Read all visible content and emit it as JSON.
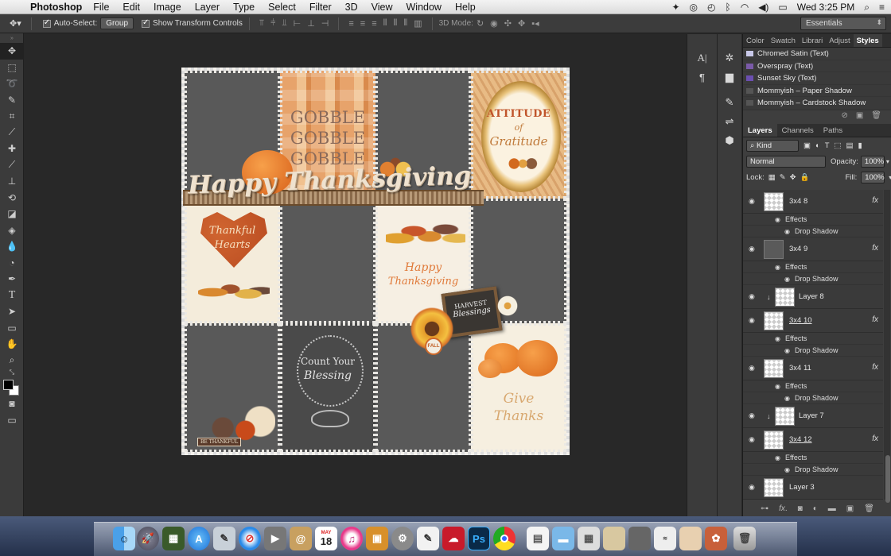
{
  "menubar": {
    "app_name": "Photoshop",
    "items": [
      "File",
      "Edit",
      "Image",
      "Layer",
      "Type",
      "Select",
      "Filter",
      "3D",
      "View",
      "Window",
      "Help"
    ],
    "clock": "Wed 3:25 PM"
  },
  "options_bar": {
    "auto_select_label": "Auto-Select:",
    "auto_select_value": "Group",
    "show_transform_label": "Show Transform Controls",
    "mode_3d_label": "3D Mode:",
    "workspace": "Essentials"
  },
  "canvas_art": {
    "gobble_lines": [
      "GOBBLE",
      "GOBBLE",
      "GOBBLE"
    ],
    "attitude_lines": [
      "ATTITUDE",
      "of",
      "Gratitude"
    ],
    "happy_thanksgiving": "Happy Thanksgiving",
    "thankful_hearts": [
      "Thankful",
      "Hearts"
    ],
    "card_happy": [
      "Happy",
      "Thanksgiving"
    ],
    "harvest_lines": [
      "HARVEST",
      "Blessings"
    ],
    "count_blessing": [
      "Count Your",
      "Blessing"
    ],
    "give_thanks": [
      "Give",
      "Thanks"
    ],
    "be_thankful": "BE THANKFUL",
    "fall_tag": "FALL"
  },
  "styles_panel": {
    "tabs": [
      "Color",
      "Swatch",
      "Librari",
      "Adjust",
      "Styles"
    ],
    "items": [
      {
        "label": "Chromed Satin (Text)",
        "color": "#c8c8e8"
      },
      {
        "label": "Overspray (Text)",
        "color": "#7a5aa8"
      },
      {
        "label": "Sunset Sky (Text)",
        "color": "#6b4fb0"
      },
      {
        "label": "Mommyish – Paper Shadow",
        "color": "#555555"
      },
      {
        "label": "Mommyish – Cardstock Shadow",
        "color": "#555555"
      }
    ]
  },
  "layers_panel": {
    "tabs": [
      "Layers",
      "Channels",
      "Paths"
    ],
    "filter_kind": "Kind",
    "blend_mode": "Normal",
    "opacity_label": "Opacity:",
    "opacity_value": "100%",
    "lock_label": "Lock:",
    "fill_label": "Fill:",
    "fill_value": "100%",
    "effects_label": "Effects",
    "drop_shadow_label": "Drop Shadow",
    "layers": [
      {
        "name": "3x4 8"
      },
      {
        "name": "3x4 9"
      },
      {
        "name": "Layer 8"
      },
      {
        "name": "3x4 10"
      },
      {
        "name": "3x4 11"
      },
      {
        "name": "Layer 7"
      },
      {
        "name": "3x4 12"
      },
      {
        "name": "Layer 3"
      }
    ]
  },
  "dock": {
    "apps": [
      "Finder",
      "Launchpad",
      "Photos",
      "App Store",
      "Preview",
      "Safari",
      "FaceTime",
      "Contacts",
      "Calendar",
      "iTunes",
      "iPhoto",
      "System Preferences",
      "TextEdit",
      "Creative Cloud",
      "Photoshop",
      "Chrome",
      "Document",
      "Folder",
      "Image",
      "Image",
      "Image",
      "Image",
      "Image",
      "Image",
      "Trash"
    ],
    "calendar_day": "18",
    "calendar_month": "MAY",
    "ps_label": "Ps"
  }
}
